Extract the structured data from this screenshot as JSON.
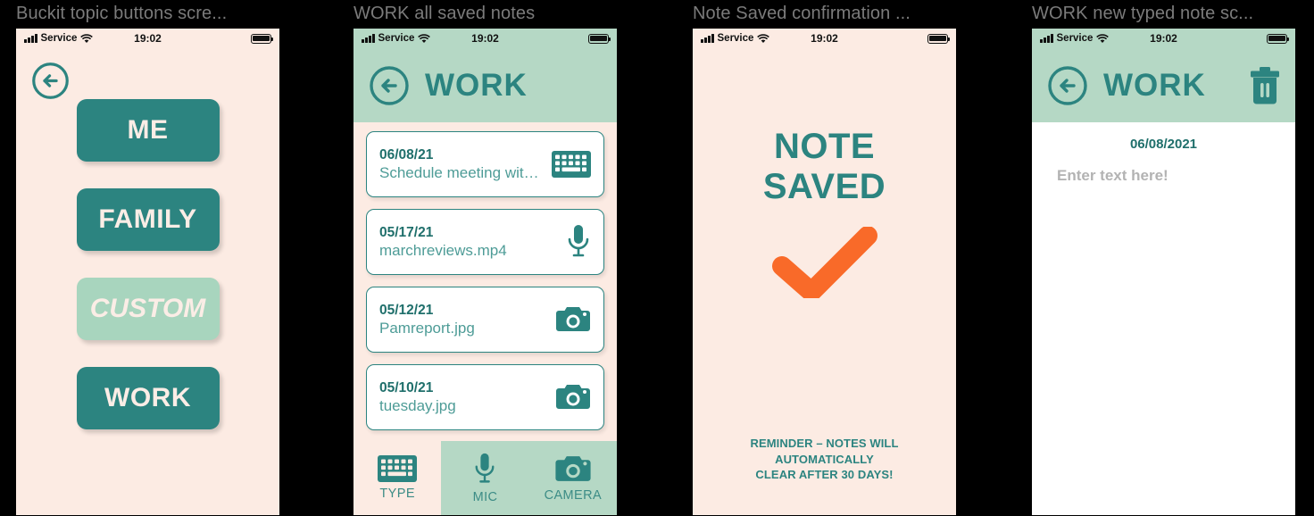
{
  "colors": {
    "teal": "#2C8480",
    "light_green": "#B5D8C5",
    "cream": "#FCEBE3",
    "mint": "#A8D5BE",
    "orange": "#F96A29",
    "white": "#FFFFFF"
  },
  "status_bar": {
    "carrier": "Service",
    "time": "19:02",
    "signal_icon": "signal-bars-icon",
    "wifi_icon": "wifi-icon",
    "battery_icon": "battery-icon"
  },
  "panels": [
    {
      "caption": "Buckit topic buttons scre...",
      "back_icon": "back-arrow-circle-icon",
      "topics": [
        {
          "label": "ME",
          "style": "solid"
        },
        {
          "label": "FAMILY",
          "style": "solid"
        },
        {
          "label": "CUSTOM",
          "style": "muted"
        },
        {
          "label": "WORK",
          "style": "solid"
        }
      ]
    },
    {
      "caption": "WORK all saved notes",
      "header": {
        "title": "WORK",
        "back_icon": "back-arrow-circle-icon"
      },
      "notes": [
        {
          "date": "06/08/21",
          "name": "Schedule meeting with Jim...",
          "icon": "keyboard-icon"
        },
        {
          "date": "05/17/21",
          "name": "marchreviews.mp4",
          "icon": "microphone-icon"
        },
        {
          "date": "05/12/21",
          "name": "Pamreport.jpg",
          "icon": "camera-icon"
        },
        {
          "date": "05/10/21",
          "name": "tuesday.jpg",
          "icon": "camera-icon"
        }
      ],
      "tabs": [
        {
          "label": "TYPE",
          "icon": "keyboard-icon",
          "active": true
        },
        {
          "label": "MIC",
          "icon": "microphone-icon",
          "active": false
        },
        {
          "label": "CAMERA",
          "icon": "camera-icon",
          "active": false
        }
      ]
    },
    {
      "caption": "Note Saved confirmation ...",
      "title_line1": "NOTE",
      "title_line2": "SAVED",
      "check_icon": "checkmark-icon",
      "reminder_line1": "REMINDER – NOTES WILL AUTOMATICALLY",
      "reminder_line2": "CLEAR AFTER 30 DAYS!"
    },
    {
      "caption": "WORK new typed note sc...",
      "header": {
        "title": "WORK",
        "back_icon": "back-arrow-circle-icon",
        "delete_icon": "trash-icon"
      },
      "note_date": "06/08/2021",
      "note_placeholder": "Enter text here!"
    }
  ]
}
